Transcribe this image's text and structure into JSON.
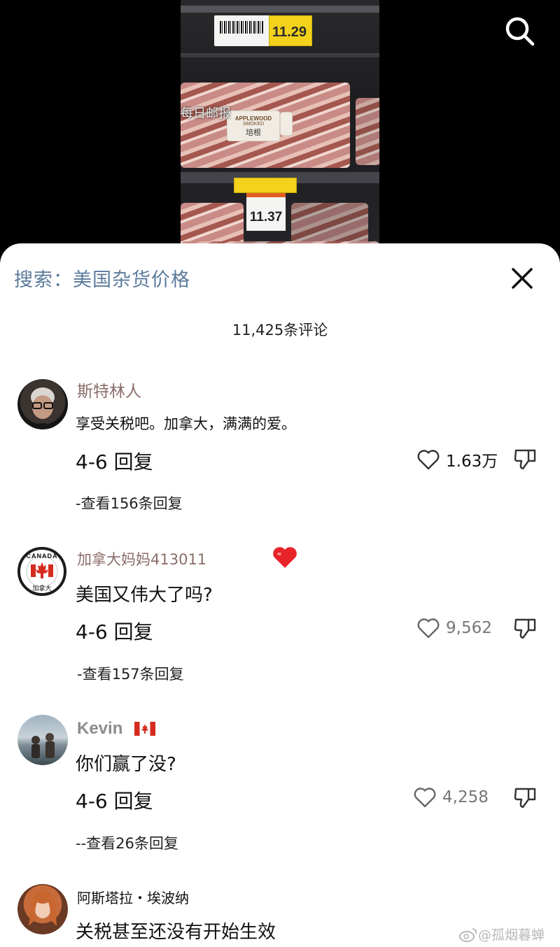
{
  "video": {
    "price_top": "11.29",
    "price_bottom": "11.37",
    "product_label_top": "APPLEWOOD",
    "product_label_sub": "SMOKED",
    "product_cn": "培根",
    "watermark": "每日邮报"
  },
  "search": {
    "title": "搜索：美国杂货价格"
  },
  "comments_count": "11,425条评论",
  "comments": [
    {
      "name": "斯特林人",
      "text": "享受关税吧。加拿大，满满的爱。",
      "reply": "4-6 回复",
      "likes": "1.63万",
      "view": "-查看156条回复"
    },
    {
      "name": "加拿大妈妈413011",
      "avatar_top": "CANADA",
      "avatar_bottom": "加拿大",
      "text": "美国又伟大了吗?",
      "reply": "4-6 回复",
      "likes": "9,562",
      "view": "-查看157条回复"
    },
    {
      "name": "Kevin",
      "text": "你们赢了没?",
      "reply": "4-6 回复",
      "likes": "4,258",
      "view": "--查看26条回复"
    },
    {
      "name": "阿斯塔拉・埃波纳",
      "text": "关税甚至还没有开始生效"
    }
  ],
  "footer_watermark": "@孤烟暮蝉",
  "colors": {
    "name": "#8a6d6a",
    "search": "#5c7a9c",
    "heart_emoji": "#e8242a"
  }
}
